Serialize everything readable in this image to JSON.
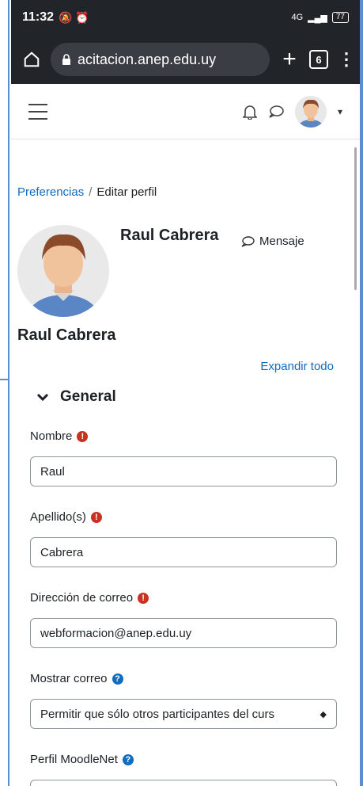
{
  "status_bar": {
    "time": "11:32",
    "network": "4G",
    "battery": "77"
  },
  "browser": {
    "url": "acitacion.anep.edu.uy",
    "tab_count": "6"
  },
  "breadcrumb": {
    "parent": "Preferencias",
    "separator": "/",
    "current": "Editar perfil"
  },
  "profile": {
    "header_name": "Raul Cabrera",
    "message_label": "Mensaje",
    "page_title": "Raul Cabrera"
  },
  "form": {
    "expand_all": "Expandir todo",
    "section_title": "General",
    "fields": [
      {
        "label": "Nombre",
        "value": "Raul"
      },
      {
        "label": "Apellido(s)",
        "value": "Cabrera"
      },
      {
        "label": "Dirección de correo",
        "value": "webformacion@anep.edu.uy"
      },
      {
        "label": "Mostrar correo",
        "value": "Permitir que sólo otros participantes del curs"
      },
      {
        "label": "Perfil MoodleNet",
        "value": ""
      }
    ]
  },
  "colors": {
    "link": "#0f6cbf",
    "required": "#ca3120",
    "browser_bar": "#212529"
  }
}
